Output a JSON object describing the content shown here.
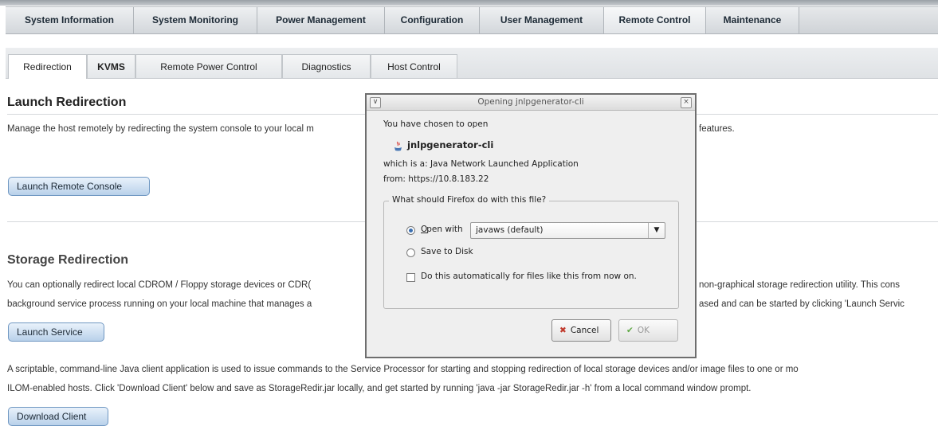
{
  "nav": {
    "main_tabs": [
      {
        "label": "System Information"
      },
      {
        "label": "System Monitoring"
      },
      {
        "label": "Power Management"
      },
      {
        "label": "Configuration"
      },
      {
        "label": "User Management"
      },
      {
        "label": "Remote Control",
        "active": true
      },
      {
        "label": "Maintenance"
      }
    ],
    "sub_tabs": [
      {
        "label": "Redirection",
        "active": true
      },
      {
        "label": "KVMS"
      },
      {
        "label": "Remote Power Control"
      },
      {
        "label": "Diagnostics"
      },
      {
        "label": "Host Control"
      }
    ]
  },
  "launch": {
    "heading": "Launch Redirection",
    "description_left": "Manage the host remotely by redirecting the system console to your local m",
    "description_right": "features.",
    "button": "Launch Remote Console"
  },
  "storage": {
    "heading": "Storage Redirection",
    "line1_left": "You can optionally redirect local CDROM / Floppy storage devices or CDR(",
    "line1_right": "non-graphical storage redirection utility. This cons",
    "line2_left": "background service process running on your local machine that manages a",
    "line2_right": "ased and can be started by clicking 'Launch Servic",
    "launch_button": "Launch Service",
    "client_line1": "A scriptable, command-line Java client application is used to issue commands to the Service Processor for starting and stopping redirection of local storage devices and/or image files to one or mo",
    "client_line2": "ILOM-enabled hosts. Click 'Download Client' below and save as StorageRedir.jar locally, and get started by running 'java -jar StorageRedir.jar -h' from a local command window prompt.",
    "download_button": "Download Client"
  },
  "dialog": {
    "title": "Opening jnlpgenerator-cli",
    "chosen_text": "You have chosen to open",
    "filename": "jnlpgenerator-cli",
    "which_is": "which is a:  Java Network Launched Application",
    "from": "from:  https://10.8.183.22",
    "group_label": "What should Firefox do with this file?",
    "open_with_label": "Open with",
    "open_with_value": "javaws (default)",
    "save_label": "Save to Disk",
    "auto_label": "Do this automatically for files like this from now on.",
    "cancel_label": "Cancel",
    "ok_label": "OK",
    "open_with_selected": true,
    "auto_checked": false
  }
}
